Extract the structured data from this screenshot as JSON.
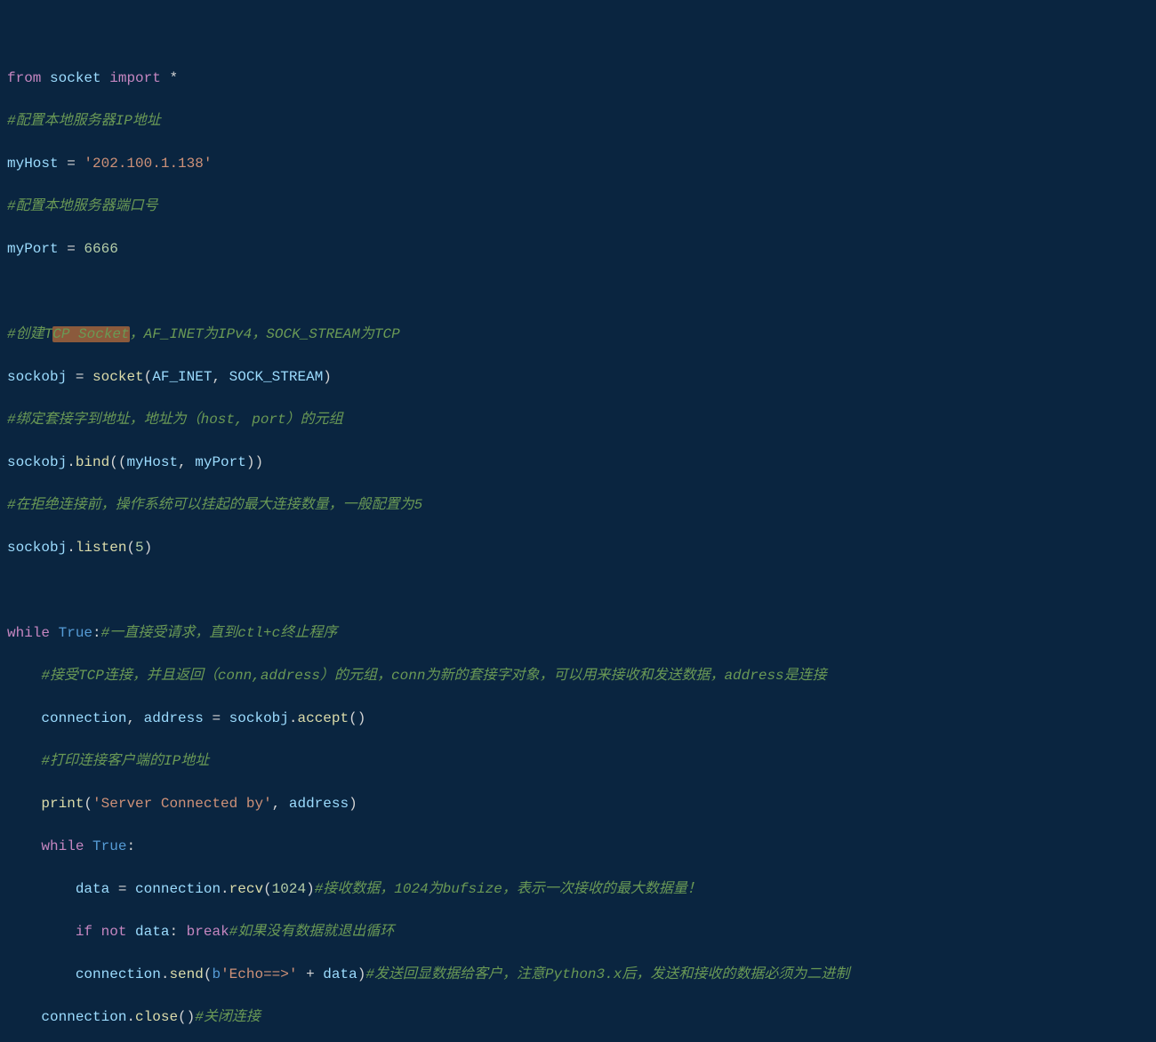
{
  "code": {
    "l1": {
      "kw_from": "from",
      "mod": "socket",
      "kw_import": "import",
      "star": "*"
    },
    "l2": {
      "cmt": "#配置本地服务器IP地址"
    },
    "l3": {
      "var": "myHost",
      "eq": " = ",
      "str": "'202.100.1.138'"
    },
    "l4": {
      "cmt": "#配置本地服务器端口号"
    },
    "l5": {
      "var": "myPort",
      "eq": " = ",
      "num": "6666"
    },
    "l6": {},
    "l7": {
      "cmt_a": "#创建T",
      "cmt_hl": "CP Socket",
      "cmt_b": "，AF_INET为IPv4，SOCK_STREAM为TCP"
    },
    "l8": {
      "var": "sockobj",
      "eq": " = ",
      "fn": "socket",
      "lp": "(",
      "a1": "AF_INET",
      "c": ", ",
      "a2": "SOCK_STREAM",
      "rp": ")"
    },
    "l9": {
      "cmt": "#绑定套接字到地址，地址为（host, port）的元组"
    },
    "l10": {
      "obj": "sockobj",
      "dot": ".",
      "fn": "bind",
      "lp": "((",
      "a1": "myHost",
      "c": ", ",
      "a2": "myPort",
      "rp": "))"
    },
    "l11": {
      "cmt": "#在拒绝连接前，操作系统可以挂起的最大连接数量，一般配置为5"
    },
    "l12": {
      "obj": "sockobj",
      "dot": ".",
      "fn": "listen",
      "lp": "(",
      "num": "5",
      "rp": ")"
    },
    "l13": {},
    "l14": {
      "kw": "while",
      "sp": " ",
      "true": "True",
      "colon": ":",
      "cmt": "#一直接受请求，直到ctl+c终止程序"
    },
    "l15": {
      "indent": "    ",
      "cmt": "#接受TCP连接，并且返回（conn,address）的元组，conn为新的套接字对象，可以用来接收和发送数据，address是连接"
    },
    "l16": {
      "indent": "    ",
      "v1": "connection",
      "c1": ", ",
      "v2": "address",
      "eq": " = ",
      "obj": "sockobj",
      "dot": ".",
      "fn": "accept",
      "pr": "()"
    },
    "l17": {
      "indent": "    ",
      "cmt": "#打印连接客户端的IP地址"
    },
    "l18": {
      "indent": "    ",
      "fn": "print",
      "lp": "(",
      "str": "'Server Connected by'",
      "c": ", ",
      "arg": "address",
      "rp": ")"
    },
    "l19": {
      "indent": "    ",
      "kw": "while",
      "sp": " ",
      "true": "True",
      "colon": ":"
    },
    "l20": {
      "indent": "        ",
      "var": "data",
      "eq": " = ",
      "obj": "connection",
      "dot": ".",
      "fn": "recv",
      "lp": "(",
      "num": "1024",
      "rp": ")",
      "cmt": "#接收数据，1024为bufsize，表示一次接收的最大数据量！"
    },
    "l21": {
      "indent": "        ",
      "kw_if": "if",
      "sp1": " ",
      "kw_not": "not",
      "sp2": " ",
      "var": "data",
      "colon": ": ",
      "kw_break": "break",
      "cmt": "#如果没有数据就退出循环"
    },
    "l22": {
      "indent": "        ",
      "obj": "connection",
      "dot": ".",
      "fn": "send",
      "lp": "(",
      "pfx": "b",
      "str": "'Echo==>'",
      "plus": " + ",
      "var": "data",
      "rp": ")",
      "cmt": "#发送回显数据给客户，注意Python3.x后，发送和接收的数据必须为二进制"
    },
    "l23": {
      "indent": "    ",
      "obj": "connection",
      "dot": ".",
      "fn": "close",
      "pr": "()",
      "cmt": "#关闭连接"
    }
  }
}
